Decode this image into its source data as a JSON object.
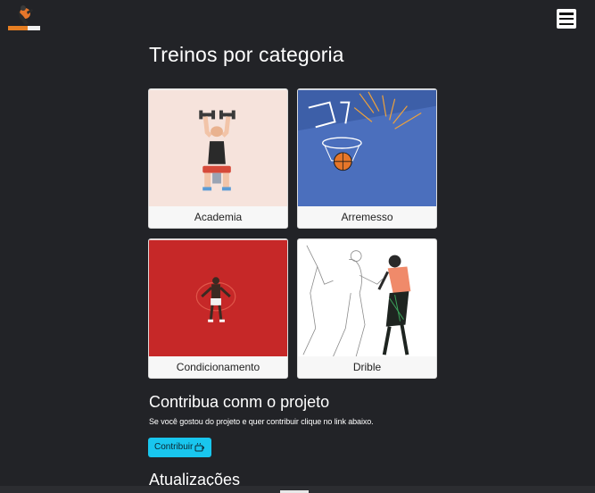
{
  "header": {
    "logo_icon": "basketball-player-logo-icon",
    "menu_icon": "hamburger-menu-icon"
  },
  "main": {
    "title": "Treinos por categoria",
    "categories": [
      {
        "label": "Academia",
        "bg": "#f6e3dc"
      },
      {
        "label": "Arremesso",
        "bg": "#4b6fbd"
      },
      {
        "label": "Condicionamento",
        "bg": "#c62828"
      },
      {
        "label": "Drible",
        "bg": "#ffffff"
      }
    ]
  },
  "contribute": {
    "title": "Contribua conm o projeto",
    "text": "Se você gostou do projeto e quer contribuir clique no link abaixo.",
    "button_label": "Contribuir",
    "button_icon": "coffee-cup-icon",
    "button_color": "#19c6ee"
  },
  "updates": {
    "title": "Atualizações"
  }
}
